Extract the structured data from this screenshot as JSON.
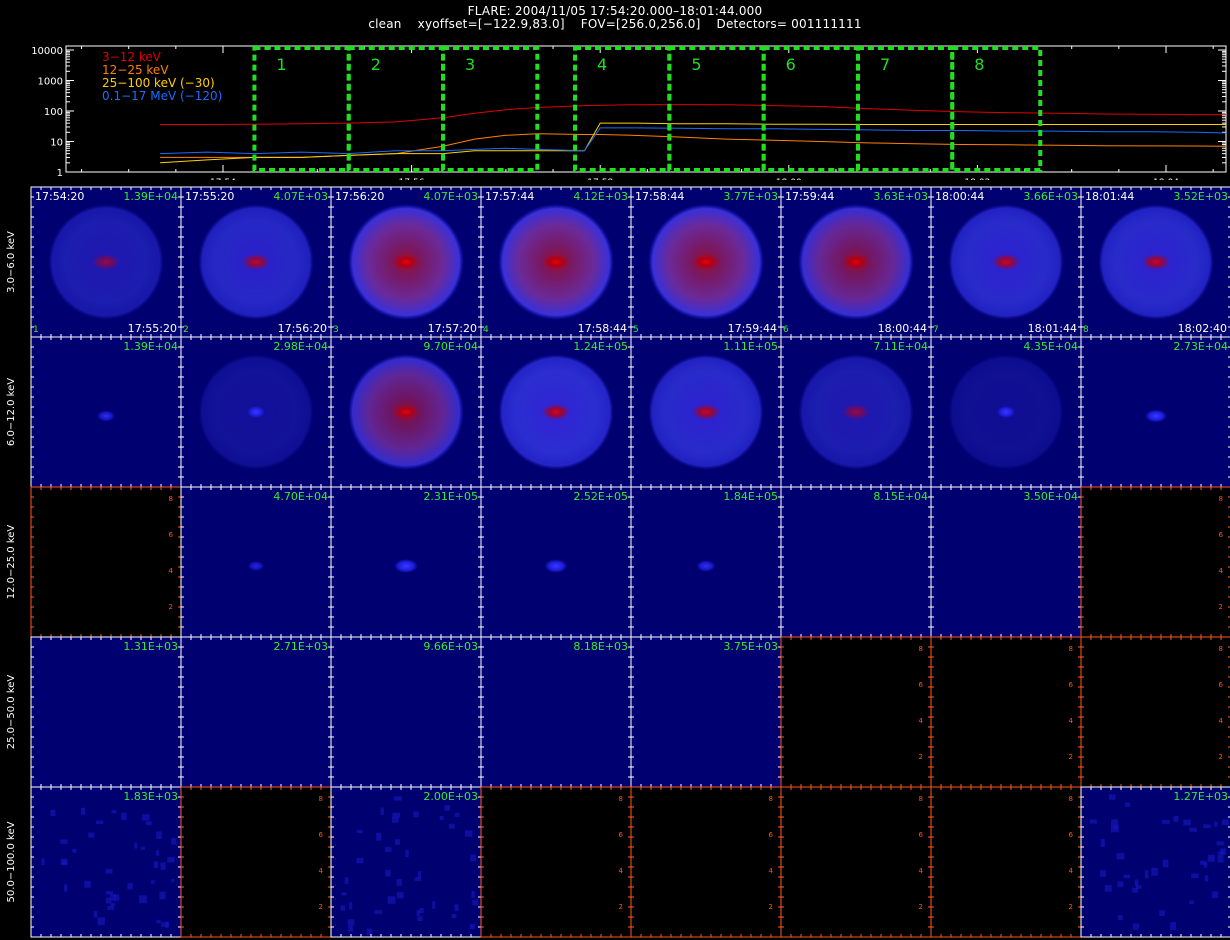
{
  "header": {
    "line1": "FLARE: 2004/11/05 17:54:20.000–18:01:44.000",
    "line2": "clean    xyoffset=[−122.9,83.0]    FOV=[256.0,256.0]    Detectors= 001111111"
  },
  "chart_data": [
    {
      "type": "line",
      "ylabel": "",
      "xlabel": "",
      "y_scale": "log",
      "ylim": [
        1,
        10000
      ],
      "y_tick_labels": [
        "1",
        "10",
        "100",
        "1000",
        "10000"
      ],
      "y_tick_values": [
        1,
        10,
        100,
        1000,
        10000
      ],
      "xlim_minutes": [
        17.4,
        25.9
      ],
      "x_tick_labels": [
        "17:54",
        "17:56",
        "17:58",
        "18:00",
        "18:02",
        "18:04"
      ],
      "x_tick_values_minutes": [
        17.9,
        19.9,
        21.9,
        23.9,
        25.9,
        27.9
      ],
      "legend_placement": "top-left",
      "series": [
        {
          "name": "3−12 keV",
          "color": "#e00000",
          "x_time": [
            "17:53:20",
            "17:53:50",
            "17:54:20",
            "17:54:50",
            "17:55:20",
            "17:55:50",
            "17:56:20",
            "17:56:40",
            "17:57:00",
            "17:57:20",
            "17:57:50",
            "17:58:20",
            "17:58:50",
            "17:59:20",
            "17:59:50",
            "18:00:20",
            "18:00:50",
            "18:01:20",
            "18:01:50",
            "18:02:20",
            "18:02:50",
            "18:03:20",
            "18:03:50",
            "18:04:20",
            "18:04:50"
          ],
          "values": [
            36,
            36,
            37,
            38,
            40,
            44,
            60,
            85,
            110,
            130,
            150,
            160,
            162,
            160,
            150,
            140,
            120,
            105,
            95,
            88,
            84,
            80,
            78,
            76,
            75
          ]
        },
        {
          "name": "12−25 keV",
          "color": "#ff8000",
          "x_time": [
            "17:53:20",
            "17:53:50",
            "17:54:20",
            "17:54:50",
            "17:55:20",
            "17:55:50",
            "17:56:20",
            "17:56:40",
            "17:57:00",
            "17:57:20",
            "17:57:50",
            "17:58:00",
            "17:58:20",
            "17:58:50",
            "17:59:20",
            "17:59:50",
            "18:00:20",
            "18:00:50",
            "18:01:20",
            "18:01:50",
            "18:02:20",
            "18:02:50",
            "18:03:20",
            "18:03:50",
            "18:04:20",
            "18:04:50"
          ],
          "values": [
            3,
            3,
            3,
            3,
            3.5,
            4,
            7,
            12,
            16,
            18,
            17,
            17,
            16,
            14,
            12,
            11,
            10,
            9,
            8.5,
            8,
            7.8,
            7.5,
            7.3,
            7.2,
            7.1,
            7
          ]
        },
        {
          "name": "25−100 keV (−30)",
          "color": "#ffd000",
          "x_time": [
            "17:53:20",
            "17:53:50",
            "17:54:20",
            "17:54:50",
            "17:55:20",
            "17:55:50",
            "17:56:20",
            "17:56:40",
            "17:57:00",
            "17:57:20",
            "17:57:50",
            "17:58:00",
            "17:58:20",
            "17:58:50",
            "17:59:20",
            "17:59:50",
            "18:00:20",
            "18:00:50",
            "18:01:20",
            "18:01:50",
            "18:02:20",
            "18:02:50",
            "18:03:20",
            "18:03:50",
            "18:04:20",
            "18:04:50"
          ],
          "values": [
            2,
            2.5,
            3,
            3,
            3.5,
            4,
            4,
            5,
            5,
            5,
            5,
            40,
            40,
            38,
            38,
            37,
            37,
            36,
            36,
            36,
            36,
            36,
            36,
            36,
            36,
            36
          ]
        },
        {
          "name": "0.1−17 MeV (−120)",
          "color": "#1a6cff",
          "x_time": [
            "17:53:20",
            "17:53:50",
            "17:54:20",
            "17:54:50",
            "17:55:20",
            "17:55:50",
            "17:56:20",
            "17:56:40",
            "17:57:00",
            "17:57:20",
            "17:57:50",
            "17:58:00",
            "17:58:20",
            "17:58:50",
            "17:59:20",
            "17:59:50",
            "18:00:20",
            "18:00:50",
            "18:01:20",
            "18:01:50",
            "18:02:20",
            "18:02:50",
            "18:03:20",
            "18:03:50",
            "18:04:20",
            "18:04:50"
          ],
          "values": [
            4,
            4.5,
            4,
            4.5,
            4,
            5,
            5,
            5.5,
            6,
            5.5,
            5,
            28,
            28,
            27,
            26,
            26,
            25,
            24,
            23,
            23,
            22,
            22,
            21,
            21,
            20,
            19
          ]
        }
      ],
      "intervals": [
        {
          "label": "1",
          "start": "17:54:20",
          "end": "17:55:20"
        },
        {
          "label": "2",
          "start": "17:55:20",
          "end": "17:56:20"
        },
        {
          "label": "3",
          "start": "17:56:20",
          "end": "17:57:20"
        },
        {
          "label": "4",
          "start": "17:57:44",
          "end": "17:58:44"
        },
        {
          "label": "5",
          "start": "17:58:44",
          "end": "17:59:44"
        },
        {
          "label": "6",
          "start": "17:59:44",
          "end": "18:00:44"
        },
        {
          "label": "7",
          "start": "18:00:44",
          "end": "18:01:44"
        },
        {
          "label": "8",
          "start": "18:01:44",
          "end": "18:02:40"
        }
      ],
      "interval_color": "#22dd22"
    },
    {
      "type": "heatmap",
      "image_grid": {
        "row_labels": [
          "3.0−6.0 keV",
          "6.0−12.0 keV",
          "12.0−25.0 keV",
          "25.0−50.0 keV",
          "50.0−100.0 keV"
        ],
        "column_start_times": [
          "17:54:20",
          "17:55:20",
          "17:56:20",
          "17:57:44",
          "17:58:44",
          "17:59:44",
          "18:00:44",
          "18:01:44"
        ],
        "column_end_times": [
          "17:55:20",
          "17:56:20",
          "17:57:20",
          "17:58:44",
          "17:59:44",
          "18:00:44",
          "18:01:44",
          "18:02:40"
        ],
        "column_numbers": [
          "1",
          "2",
          "3",
          "4",
          "5",
          "6",
          "7",
          "8"
        ],
        "cells": [
          [
            {
              "peak": "1.39E+04",
              "img": "ring",
              "level": 0.55
            },
            {
              "peak": "4.07E+03",
              "img": "ring",
              "level": 0.75
            },
            {
              "peak": "4.07E+03",
              "img": "ring",
              "level": 1.0
            },
            {
              "peak": "4.12E+03",
              "img": "ring",
              "level": 1.0
            },
            {
              "peak": "3.77E+03",
              "img": "ring",
              "level": 1.0
            },
            {
              "peak": "3.63E+03",
              "img": "ring",
              "level": 0.95
            },
            {
              "peak": "3.66E+03",
              "img": "ring",
              "level": 0.8
            },
            {
              "peak": "3.52E+03",
              "img": "ring",
              "level": 0.8
            }
          ],
          [
            {
              "peak": "1.39E+04",
              "img": "spot",
              "level": 0.3
            },
            {
              "peak": "2.98E+04",
              "img": "ring",
              "level": 0.35
            },
            {
              "peak": "9.70E+04",
              "img": "ring",
              "level": 0.9
            },
            {
              "peak": "1.24E+05",
              "img": "ring",
              "level": 0.85
            },
            {
              "peak": "1.11E+05",
              "img": "ring",
              "level": 0.8
            },
            {
              "peak": "7.11E+04",
              "img": "ring",
              "level": 0.55
            },
            {
              "peak": "4.35E+04",
              "img": "ring",
              "level": 0.3
            },
            {
              "peak": "2.73E+04",
              "img": "spot",
              "level": 0.5
            }
          ],
          [
            {
              "peak": "",
              "img": "empty",
              "level": 0
            },
            {
              "peak": "4.70E+04",
              "img": "spot",
              "level": 0.2
            },
            {
              "peak": "2.31E+05",
              "img": "spot",
              "level": 0.6
            },
            {
              "peak": "2.52E+05",
              "img": "spot",
              "level": 0.55
            },
            {
              "peak": "1.84E+05",
              "img": "spot",
              "level": 0.35
            },
            {
              "peak": "8.15E+04",
              "img": "plain",
              "level": 0
            },
            {
              "peak": "3.50E+04",
              "img": "plain",
              "level": 0
            },
            {
              "peak": "",
              "img": "empty",
              "level": 0
            }
          ],
          [
            {
              "peak": "1.31E+03",
              "img": "plain",
              "level": 0
            },
            {
              "peak": "2.71E+03",
              "img": "plain",
              "level": 0
            },
            {
              "peak": "9.66E+03",
              "img": "plain",
              "level": 0
            },
            {
              "peak": "8.18E+03",
              "img": "plain",
              "level": 0
            },
            {
              "peak": "3.75E+03",
              "img": "plain",
              "level": 0
            },
            {
              "peak": "",
              "img": "empty",
              "level": 0
            },
            {
              "peak": "",
              "img": "empty",
              "level": 0
            },
            {
              "peak": "",
              "img": "empty",
              "level": 0
            }
          ],
          [
            {
              "peak": "1.83E+03",
              "img": "noise",
              "level": 0.3
            },
            {
              "peak": "",
              "img": "empty",
              "level": 0
            },
            {
              "peak": "2.00E+03",
              "img": "noise",
              "level": 0.3
            },
            {
              "peak": "",
              "img": "empty",
              "level": 0
            },
            {
              "peak": "",
              "img": "empty",
              "level": 0
            },
            {
              "peak": "",
              "img": "empty",
              "level": 0
            },
            {
              "peak": "",
              "img": "empty",
              "level": 0
            },
            {
              "peak": "1.27E+03",
              "img": "noise",
              "level": 0.3
            }
          ]
        ],
        "empty_axis_tick_labels": [
          "2",
          "4",
          "6",
          "8"
        ],
        "peak_label_color": "#33ee33",
        "empty_axis_color": "#ff5522"
      }
    }
  ]
}
